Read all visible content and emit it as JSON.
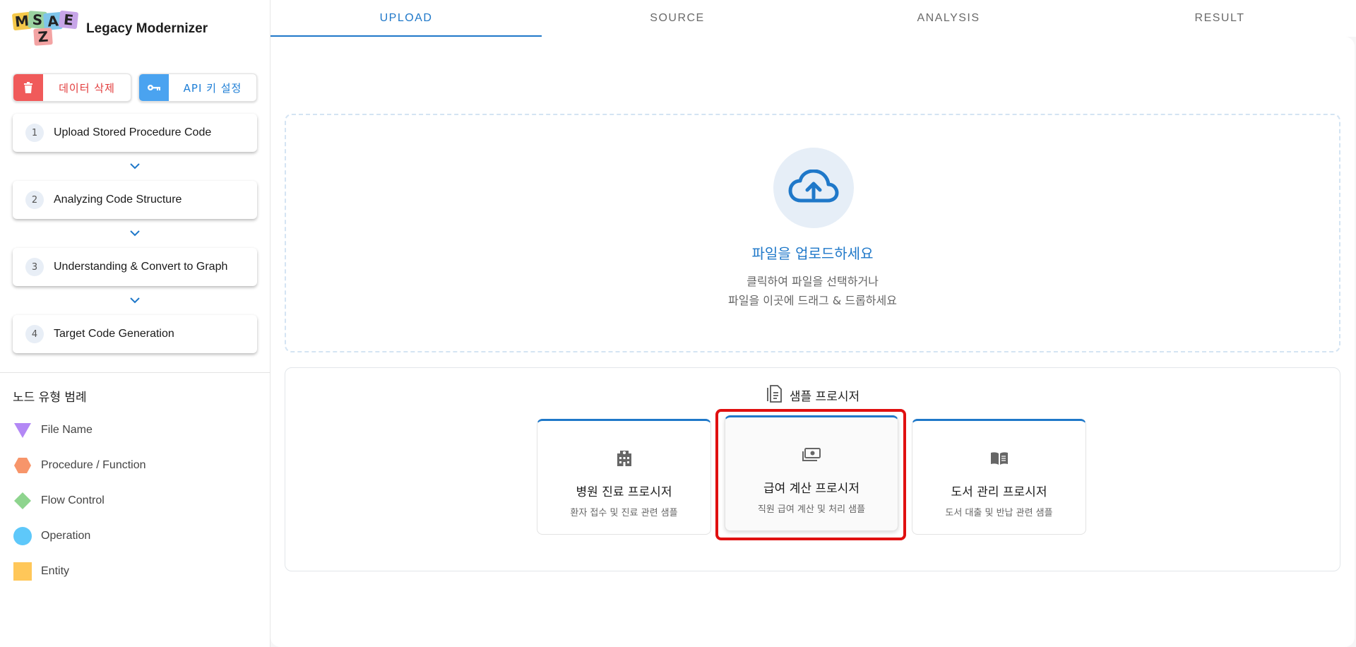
{
  "brand": {
    "logo_letters": [
      "M",
      "S",
      "A",
      "E",
      "Z"
    ],
    "name": "Legacy Modernizer"
  },
  "actions": {
    "delete_label": "데이터 삭제",
    "api_label": "API 키 설정"
  },
  "steps": [
    {
      "num": "1",
      "label": "Upload Stored Procedure Code"
    },
    {
      "num": "2",
      "label": "Analyzing Code Structure"
    },
    {
      "num": "3",
      "label": "Understanding & Convert to Graph"
    },
    {
      "num": "4",
      "label": "Target Code Generation"
    }
  ],
  "legend": {
    "title": "노드 유형 범례",
    "items": [
      {
        "label": "File Name",
        "shape": "triangle",
        "color": "#b388f5"
      },
      {
        "label": "Procedure / Function",
        "shape": "hexagon",
        "color": "#f7956a"
      },
      {
        "label": "Flow Control",
        "shape": "diamond",
        "color": "#8ed48e"
      },
      {
        "label": "Operation",
        "shape": "circle",
        "color": "#5ec8fa"
      },
      {
        "label": "Entity",
        "shape": "square",
        "color": "#ffc759"
      }
    ]
  },
  "tabs": [
    {
      "label": "UPLOAD",
      "active": true
    },
    {
      "label": "SOURCE",
      "active": false
    },
    {
      "label": "ANALYSIS",
      "active": false
    },
    {
      "label": "RESULT",
      "active": false
    }
  ],
  "upload": {
    "title": "파일을 업로드하세요",
    "line1": "클릭하여 파일을 선택하거나",
    "line2": "파일을 이곳에 드래그 & 드롭하세요"
  },
  "samples": {
    "heading": "샘플 프로시저",
    "cards": [
      {
        "icon": "hospital-icon",
        "title": "병원 진료 프로시저",
        "desc": "환자 접수 및 진료 관련 샘플"
      },
      {
        "icon": "money-icon",
        "title": "급여 계산 프로시저",
        "desc": "직원 급여 계산 및 처리 샘플"
      },
      {
        "icon": "book-icon",
        "title": "도서 관리 프로시저",
        "desc": "도서 대출 및 반납 관련 샘플"
      }
    ]
  },
  "colors": {
    "accent": "#1f78c9",
    "danger": "#f05a5a",
    "api": "#4aa3f0",
    "highlight": "#e01010"
  }
}
